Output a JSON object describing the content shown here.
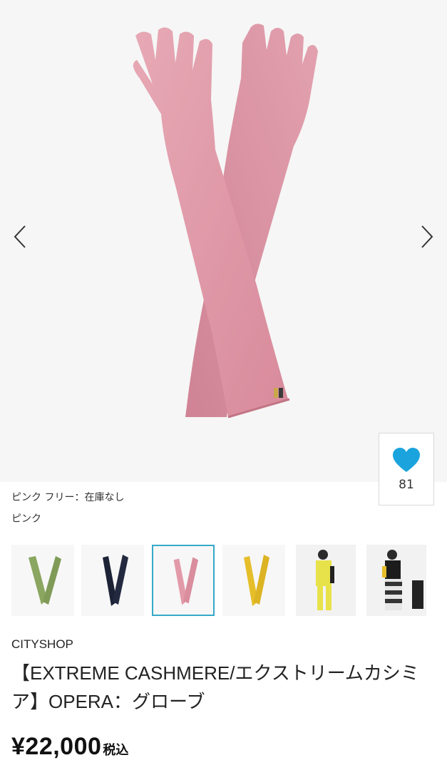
{
  "product": {
    "image_alt": "pink long cashmere gloves",
    "favorite_count": "81",
    "variant_status": "ピンク フリー：在庫なし",
    "selected_color": "ピンク",
    "brand": "CITYSHOP",
    "title": "【EXTREME CASHMERE/エクストリームカシミア】OPERA：グローブ",
    "price": "¥22,000",
    "tax_label": "税込"
  },
  "thumbnails": [
    {
      "color_name": "green",
      "hex": "#8aa660"
    },
    {
      "color_name": "navy",
      "hex": "#1d2336"
    },
    {
      "color_name": "pink",
      "hex": "#e29aa9",
      "selected": true
    },
    {
      "color_name": "yellow",
      "hex": "#e5be2a"
    },
    {
      "color_name": "model-yellow-outfit",
      "hex": "#e8e24a"
    },
    {
      "color_name": "model-black-outfit",
      "hex": "#1c1c1c"
    }
  ],
  "colors": {
    "heart": "#1aa3dd",
    "selected_border": "#35a9c7",
    "glove_pink": "#df98a7"
  },
  "icons": {
    "prev": "chevron-left-icon",
    "next": "chevron-right-icon",
    "favorite": "heart-icon"
  }
}
